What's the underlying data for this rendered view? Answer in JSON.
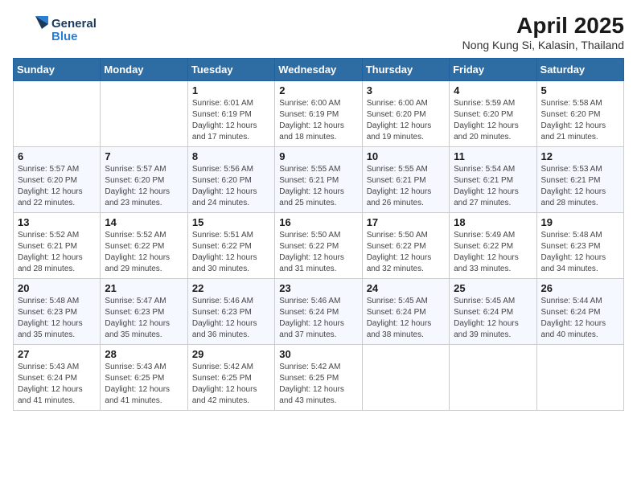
{
  "logo": {
    "line1": "General",
    "line2": "Blue"
  },
  "title": "April 2025",
  "subtitle": "Nong Kung Si, Kalasin, Thailand",
  "weekdays": [
    "Sunday",
    "Monday",
    "Tuesday",
    "Wednesday",
    "Thursday",
    "Friday",
    "Saturday"
  ],
  "weeks": [
    [
      {
        "day": "",
        "info": ""
      },
      {
        "day": "",
        "info": ""
      },
      {
        "day": "1",
        "info": "Sunrise: 6:01 AM\nSunset: 6:19 PM\nDaylight: 12 hours and 17 minutes."
      },
      {
        "day": "2",
        "info": "Sunrise: 6:00 AM\nSunset: 6:19 PM\nDaylight: 12 hours and 18 minutes."
      },
      {
        "day": "3",
        "info": "Sunrise: 6:00 AM\nSunset: 6:20 PM\nDaylight: 12 hours and 19 minutes."
      },
      {
        "day": "4",
        "info": "Sunrise: 5:59 AM\nSunset: 6:20 PM\nDaylight: 12 hours and 20 minutes."
      },
      {
        "day": "5",
        "info": "Sunrise: 5:58 AM\nSunset: 6:20 PM\nDaylight: 12 hours and 21 minutes."
      }
    ],
    [
      {
        "day": "6",
        "info": "Sunrise: 5:57 AM\nSunset: 6:20 PM\nDaylight: 12 hours and 22 minutes."
      },
      {
        "day": "7",
        "info": "Sunrise: 5:57 AM\nSunset: 6:20 PM\nDaylight: 12 hours and 23 minutes."
      },
      {
        "day": "8",
        "info": "Sunrise: 5:56 AM\nSunset: 6:20 PM\nDaylight: 12 hours and 24 minutes."
      },
      {
        "day": "9",
        "info": "Sunrise: 5:55 AM\nSunset: 6:21 PM\nDaylight: 12 hours and 25 minutes."
      },
      {
        "day": "10",
        "info": "Sunrise: 5:55 AM\nSunset: 6:21 PM\nDaylight: 12 hours and 26 minutes."
      },
      {
        "day": "11",
        "info": "Sunrise: 5:54 AM\nSunset: 6:21 PM\nDaylight: 12 hours and 27 minutes."
      },
      {
        "day": "12",
        "info": "Sunrise: 5:53 AM\nSunset: 6:21 PM\nDaylight: 12 hours and 28 minutes."
      }
    ],
    [
      {
        "day": "13",
        "info": "Sunrise: 5:52 AM\nSunset: 6:21 PM\nDaylight: 12 hours and 28 minutes."
      },
      {
        "day": "14",
        "info": "Sunrise: 5:52 AM\nSunset: 6:22 PM\nDaylight: 12 hours and 29 minutes."
      },
      {
        "day": "15",
        "info": "Sunrise: 5:51 AM\nSunset: 6:22 PM\nDaylight: 12 hours and 30 minutes."
      },
      {
        "day": "16",
        "info": "Sunrise: 5:50 AM\nSunset: 6:22 PM\nDaylight: 12 hours and 31 minutes."
      },
      {
        "day": "17",
        "info": "Sunrise: 5:50 AM\nSunset: 6:22 PM\nDaylight: 12 hours and 32 minutes."
      },
      {
        "day": "18",
        "info": "Sunrise: 5:49 AM\nSunset: 6:22 PM\nDaylight: 12 hours and 33 minutes."
      },
      {
        "day": "19",
        "info": "Sunrise: 5:48 AM\nSunset: 6:23 PM\nDaylight: 12 hours and 34 minutes."
      }
    ],
    [
      {
        "day": "20",
        "info": "Sunrise: 5:48 AM\nSunset: 6:23 PM\nDaylight: 12 hours and 35 minutes."
      },
      {
        "day": "21",
        "info": "Sunrise: 5:47 AM\nSunset: 6:23 PM\nDaylight: 12 hours and 35 minutes."
      },
      {
        "day": "22",
        "info": "Sunrise: 5:46 AM\nSunset: 6:23 PM\nDaylight: 12 hours and 36 minutes."
      },
      {
        "day": "23",
        "info": "Sunrise: 5:46 AM\nSunset: 6:24 PM\nDaylight: 12 hours and 37 minutes."
      },
      {
        "day": "24",
        "info": "Sunrise: 5:45 AM\nSunset: 6:24 PM\nDaylight: 12 hours and 38 minutes."
      },
      {
        "day": "25",
        "info": "Sunrise: 5:45 AM\nSunset: 6:24 PM\nDaylight: 12 hours and 39 minutes."
      },
      {
        "day": "26",
        "info": "Sunrise: 5:44 AM\nSunset: 6:24 PM\nDaylight: 12 hours and 40 minutes."
      }
    ],
    [
      {
        "day": "27",
        "info": "Sunrise: 5:43 AM\nSunset: 6:24 PM\nDaylight: 12 hours and 41 minutes."
      },
      {
        "day": "28",
        "info": "Sunrise: 5:43 AM\nSunset: 6:25 PM\nDaylight: 12 hours and 41 minutes."
      },
      {
        "day": "29",
        "info": "Sunrise: 5:42 AM\nSunset: 6:25 PM\nDaylight: 12 hours and 42 minutes."
      },
      {
        "day": "30",
        "info": "Sunrise: 5:42 AM\nSunset: 6:25 PM\nDaylight: 12 hours and 43 minutes."
      },
      {
        "day": "",
        "info": ""
      },
      {
        "day": "",
        "info": ""
      },
      {
        "day": "",
        "info": ""
      }
    ]
  ]
}
